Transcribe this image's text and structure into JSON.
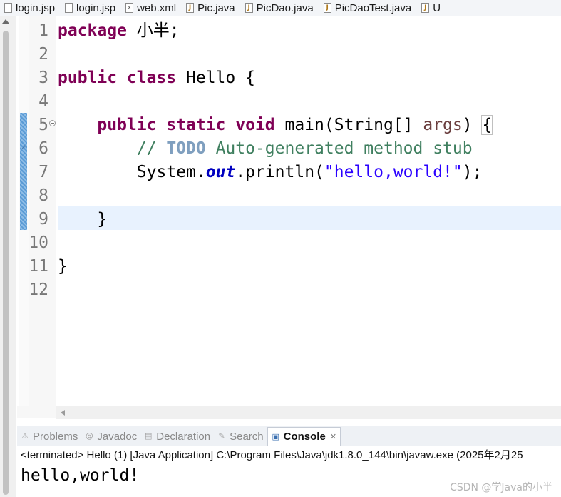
{
  "tabs": [
    {
      "label": "login.jsp",
      "icon": "file-icon"
    },
    {
      "label": "login.jsp",
      "icon": "file-icon"
    },
    {
      "label": "web.xml",
      "icon": "xml-file-icon"
    },
    {
      "label": "Pic.java",
      "icon": "java-file-icon"
    },
    {
      "label": "PicDao.java",
      "icon": "java-file-icon"
    },
    {
      "label": "PicDaoTest.java",
      "icon": "java-file-icon"
    },
    {
      "label": "U",
      "icon": "java-file-icon"
    }
  ],
  "editor": {
    "line_numbers": [
      "1",
      "2",
      "3",
      "4",
      "5",
      "6",
      "7",
      "8",
      "9",
      "10",
      "11",
      "12"
    ],
    "code": {
      "l1_kw": "package",
      "l1_rest": " 小半;",
      "l3_kw": "public class",
      "l3_rest": " Hello {",
      "l5_indent": "    ",
      "l5_kw": "public static void",
      "l5_mid": " main(String[] ",
      "l5_param": "args",
      "l5_close": ") ",
      "l5_brace": "{",
      "l6_indent": "        ",
      "l6_comment_start": "// ",
      "l6_todo": "TODO",
      "l6_comment_rest": " Auto-generated method stub",
      "l7_indent": "        ",
      "l7_pre": "System.",
      "l7_field": "out",
      "l7_mid": ".println(",
      "l7_str": "\"hello,world!\"",
      "l7_end": ");",
      "l9_indent": "    ",
      "l9_brace": "}",
      "l11_brace": "}"
    }
  },
  "panel": {
    "tabs": [
      {
        "label": "Problems",
        "icon": "problems-icon"
      },
      {
        "label": "Javadoc",
        "icon": "javadoc-icon"
      },
      {
        "label": "Declaration",
        "icon": "declaration-icon"
      },
      {
        "label": "Search",
        "icon": "search-icon"
      },
      {
        "label": "Console",
        "icon": "console-icon",
        "active": true
      }
    ],
    "close_glyph": "✕"
  },
  "console": {
    "status": "<terminated> Hello (1) [Java Application] C:\\Program Files\\Java\\jdk1.8.0_144\\bin\\javaw.exe (2025年2月25",
    "output": "hello,world!"
  },
  "watermark": "CSDN @学Java的小半",
  "colors": {
    "keyword": "#7f0055",
    "comment": "#3f7f5f",
    "string": "#2a00ff",
    "field": "#0000c0",
    "current_line": "#e8f2fe"
  }
}
